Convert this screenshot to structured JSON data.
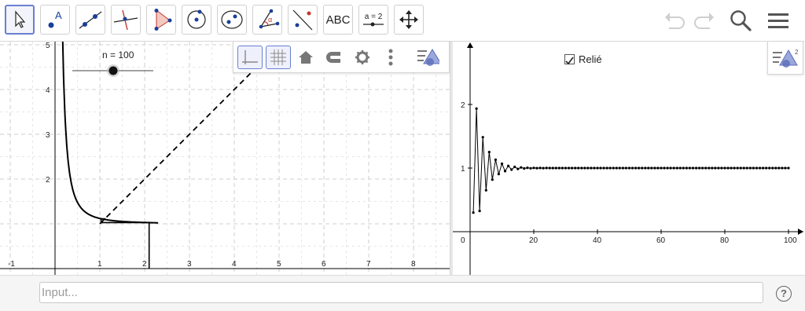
{
  "toolbar": {
    "tools": [
      {
        "name": "move-tool",
        "label": ""
      },
      {
        "name": "point-tool",
        "label": "A"
      },
      {
        "name": "line-tool",
        "label": ""
      },
      {
        "name": "perpendicular-tool",
        "label": ""
      },
      {
        "name": "polygon-tool",
        "label": ""
      },
      {
        "name": "circle-tool",
        "label": ""
      },
      {
        "name": "ellipse-tool",
        "label": ""
      },
      {
        "name": "angle-tool",
        "label": "α"
      },
      {
        "name": "reflect-tool",
        "label": ""
      },
      {
        "name": "text-tool",
        "label": "ABC"
      },
      {
        "name": "slider-tool",
        "label": "a = 2"
      },
      {
        "name": "move-graphics-tool",
        "label": ""
      }
    ],
    "right_icons": [
      "undo-icon",
      "redo-icon",
      "search-icon",
      "menu-icon"
    ]
  },
  "graphics1": {
    "slider": {
      "label": "n = 100",
      "value": 100
    },
    "x_ticks": [
      "-1",
      "1",
      "2",
      "3",
      "4",
      "5",
      "6",
      "7",
      "8"
    ],
    "y_ticks": [
      "2",
      "3",
      "4",
      "5"
    ]
  },
  "graphics2": {
    "checkbox": {
      "label": "Relié",
      "checked": true
    },
    "x_ticks": [
      "0",
      "20",
      "40",
      "60",
      "80",
      "100"
    ],
    "y_ticks": [
      "1",
      "2"
    ]
  },
  "input_bar": {
    "placeholder": "Input..."
  },
  "colors": {
    "selected_border": "#6a7fd0",
    "polygon_fill": "#f3c9c0",
    "point_color": "#1a3f9a",
    "axis": "#000000",
    "grid": "#c8c8c8"
  }
}
